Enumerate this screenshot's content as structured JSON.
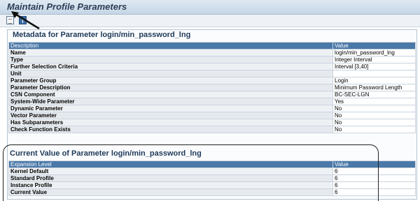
{
  "window": {
    "title": "Maintain Profile Parameters"
  },
  "toolbar": {
    "icons": [
      "document-icon",
      "info-icon"
    ]
  },
  "metadata": {
    "title": "Metadata for Parameter login/min_password_lng",
    "columns": [
      "Description",
      "Value"
    ],
    "rows": [
      {
        "label": "Name",
        "value": "login/min_password_lng"
      },
      {
        "label": "Type",
        "value": "Integer Interval"
      },
      {
        "label": "Further Selection Criteria",
        "value": "Interval [3,40]"
      },
      {
        "label": "Unit",
        "value": ""
      },
      {
        "label": "Parameter Group",
        "value": "Login"
      },
      {
        "label": "Parameter Description",
        "value": "Minimum Password Length"
      },
      {
        "label": "CSN Component",
        "value": "BC-SEC-LGN"
      },
      {
        "label": "System-Wide Parameter",
        "value": "Yes"
      },
      {
        "label": "Dynamic Parameter",
        "value": "No"
      },
      {
        "label": "Vector Parameter",
        "value": "No"
      },
      {
        "label": "Has Subparameters",
        "value": "No"
      },
      {
        "label": "Check Function Exists",
        "value": "No"
      }
    ]
  },
  "current": {
    "title": "Current Value of Parameter login/min_password_lng",
    "columns": [
      "Expansion Level",
      "Value"
    ],
    "rows": [
      {
        "label": "Kernel Default",
        "value": "6"
      },
      {
        "label": "Standard Profile",
        "value": "6"
      },
      {
        "label": "Instance Profile",
        "value": "6"
      },
      {
        "label": "Current Value",
        "value": "6"
      }
    ]
  }
}
